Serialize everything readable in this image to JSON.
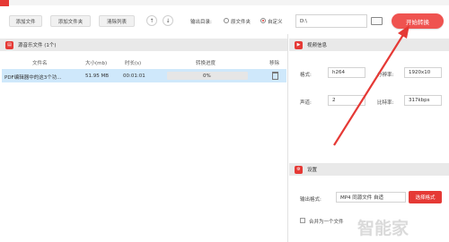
{
  "toolbar": {
    "add_file": "添加文件",
    "add_folder": "添加文件夹",
    "clear_list": "清除列表",
    "up": "↑",
    "down": "↓",
    "output_dir_label": "输出目录:",
    "radio_source": "原文件夹",
    "radio_custom": "自定义",
    "output_path": "D:\\",
    "start_button": "开始转换"
  },
  "file_panel": {
    "title": "源音乐文件 (1个)",
    "columns": [
      "文件名",
      "大小(mb)",
      "时长(s)",
      "转换进度",
      "移除"
    ],
    "rows": [
      {
        "name": "PDF编辑器中的这3个功...",
        "size": "51.95 MB",
        "duration": "00:01:01",
        "progress": "0%",
        "progress_value": 0
      }
    ]
  },
  "video_info": {
    "title": "视频信息",
    "format_label": "格式:",
    "format_value": "h264",
    "resolution_label": "分辨率:",
    "resolution_value": "1920x10",
    "channel_label": "声道:",
    "channel_value": "2",
    "bitrate_label": "比特率:",
    "bitrate_value": "317kbps"
  },
  "settings": {
    "title": "设置",
    "output_format_label": "输出格式:",
    "output_format_value": "MP4 同源文件 自适",
    "change_format_button": "选择格式",
    "merge_label": "合并为一个文件"
  },
  "watermark": "智能家",
  "colors": {
    "accent": "#e53935",
    "arrow": "#e53935",
    "selected_row": "#cfe8fb"
  }
}
